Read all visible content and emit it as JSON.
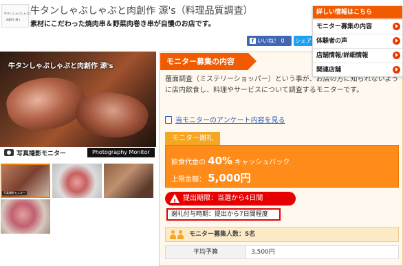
{
  "header": {
    "logo_line1": "牛タンしゃぶしゃぶと",
    "logo_line2": "肉創作 源's",
    "title": "牛タンしゃぶしゃぶと肉創作 源's（料理品質調査）",
    "subtitle": "素材にこだわった焼肉串＆野菜肉巻き串が自慢のお店です。"
  },
  "social": {
    "like_label": "いいね！ 0",
    "share_label": "シェア"
  },
  "photo": {
    "caption": "牛タンしゃぶしゃぶと肉創作 源's",
    "bar_label": "写真撮影モニター",
    "bar_badge": "Photography Monitor",
    "thumb_label": "写真撮影モニター"
  },
  "detail": {
    "section_title": "モニター募集の内容",
    "description": "覆面調査（ミステリーショッパー）という事が、お店の方に知られないように店内飲食し、料理やサービスについて調査するモニターです。",
    "survey_link": "当モニターのアンケート内容を見る",
    "reward_tab": "モニター謝礼",
    "reward_prefix": "飲食代金の",
    "reward_rate": "40%",
    "reward_suffix": "キャッシュバック",
    "limit_label": "上限金額：",
    "limit_value": "5,000円",
    "deadline": "提出期限：当選から4日間",
    "grant_timing": "謝礼付与時期：提出から7日間程度",
    "recruit_count": "モニター募集人数：5名",
    "budget_label": "平均予算",
    "budget_value": "3,500円"
  },
  "menu": {
    "header": "詳しい情報はこちら",
    "items": [
      "モニター募集の内容",
      "体験者の声",
      "店舗情報/詳細情報",
      "関連店舗"
    ]
  },
  "colors": {
    "accent": "#f05a00",
    "reward": "#ff8c1a",
    "alert": "#e60000",
    "link": "#2a5fbf"
  }
}
